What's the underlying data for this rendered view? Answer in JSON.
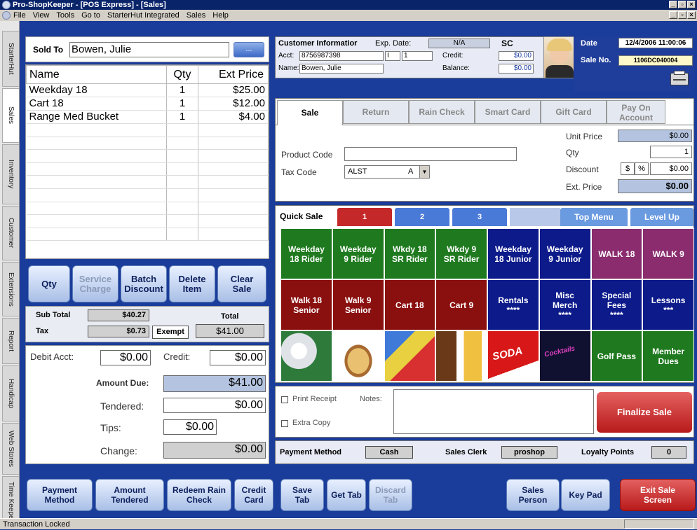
{
  "window": {
    "title": "Pro-ShopKeeper - [POS Express] - [Sales]"
  },
  "menu": [
    "File",
    "View",
    "Tools",
    "Go to",
    "StarterHut Integrated",
    "Sales",
    "Help"
  ],
  "side_tabs": [
    "StarterHut",
    "Sales",
    "Inventory",
    "Customer",
    "Extensions",
    "Report",
    "Handicap",
    "Web Stores",
    "Time Keeper"
  ],
  "sold_to": {
    "label": "Sold To",
    "value": "Bowen, Julie",
    "browse": "..."
  },
  "grid": {
    "headers": [
      "Name",
      "Qty",
      "Ext Price"
    ],
    "rows": [
      {
        "name": "Weekday 18",
        "qty": "1",
        "price": "$25.00"
      },
      {
        "name": "Cart 18",
        "qty": "1",
        "price": "$12.00"
      },
      {
        "name": "Range Med Bucket",
        "qty": "1",
        "price": "$4.00"
      }
    ]
  },
  "line_buttons": {
    "qty": "Qty",
    "service1": "Service",
    "service2": "Charge",
    "batch1": "Batch",
    "batch2": "Discount",
    "delete1": "Delete",
    "delete2": "Item",
    "clear1": "Clear",
    "clear2": "Sale"
  },
  "totals": {
    "subtotal_label": "Sub Total",
    "subtotal": "$40.27",
    "tax_label": "Tax",
    "tax": "$0.73",
    "exempt": "Exempt",
    "total_label": "Total",
    "total": "$41.00"
  },
  "payment": {
    "debit_label": "Debit Acct:",
    "debit": "$0.00",
    "credit_label": "Credit:",
    "credit": "$0.00",
    "due_label": "Amount Due:",
    "due": "$41.00",
    "tendered_label": "Tendered:",
    "tendered": "$0.00",
    "tips_label": "Tips:",
    "tips": "$0.00",
    "change_label": "Change:",
    "change": "$0.00"
  },
  "customer": {
    "title": "Customer Informatior",
    "exp_label": "Exp. Date:",
    "exp": "N/A",
    "code": "SC",
    "acct_label": "Acct:",
    "acct": "8756987398",
    "acct_f1": "I",
    "acct_f2": "1",
    "credit_label": "Credit:",
    "credit": "$0.00",
    "name_label": "Name:",
    "name": "Bowen, Julie",
    "balance_label": "Balance:",
    "balance": "$0.00"
  },
  "sale_info": {
    "date_label": "Date",
    "date": "12/4/2006 11:00:06",
    "saleno_label": "Sale No.",
    "saleno": "1106DC040004"
  },
  "sale_tabs": [
    "Sale",
    "Return",
    "Rain Check",
    "Smart Card",
    "Gift Card",
    "Pay On Account"
  ],
  "product": {
    "code_label": "Product Code",
    "code": "",
    "tax_label": "Tax Code",
    "tax": "ALST",
    "tax_opt": "A",
    "unit_label": "Unit Price",
    "unit": "$0.00",
    "qty_label": "Qty",
    "qty": "1",
    "disc_label": "Discount",
    "disc_cur": "$",
    "disc_pct": "%",
    "disc": "$0.00",
    "ext_label": "Ext. Price",
    "ext": "$0.00"
  },
  "quick_sale": {
    "label": "Quick Sale",
    "tabs": [
      "1",
      "2",
      "3"
    ],
    "top_menu": "Top Menu",
    "level_up": "Level Up",
    "buttons": [
      [
        "Weekday",
        "18 Rider"
      ],
      [
        "Weekday",
        "9 Rider"
      ],
      [
        "Wkdy 18",
        "SR Rider"
      ],
      [
        "Wkdy 9",
        "SR Rider"
      ],
      [
        "Weekday",
        "18 Junior"
      ],
      [
        "Weekday",
        "9 Junior"
      ],
      [
        "WALK 18",
        ""
      ],
      [
        "WALK 9",
        ""
      ],
      [
        "Walk 18",
        "Senior"
      ],
      [
        "Walk 9",
        "Senior"
      ],
      [
        "Cart 18",
        ""
      ],
      [
        "Cart 9",
        ""
      ],
      [
        "Rentals",
        "****"
      ],
      [
        "Misc",
        "Merch",
        "****"
      ],
      [
        "Special",
        "Fees",
        "****"
      ],
      [
        "Lessons",
        "***"
      ],
      [
        "Golf Pass",
        ""
      ],
      [
        "Member",
        "Dues"
      ]
    ],
    "image_text": [
      "SODA",
      "Cocktails"
    ]
  },
  "receipt": {
    "print": "Print Receipt",
    "notes_label": "Notes:",
    "extra": "Extra Copy",
    "finalize": "Finalize Sale"
  },
  "paybar": {
    "method_label": "Payment Method",
    "method": "Cash",
    "clerk_label": "Sales Clerk",
    "clerk": "proshop",
    "loyalty_label": "Loyalty Points",
    "loyalty": "0"
  },
  "bottom_buttons": [
    [
      "Payment",
      "Method"
    ],
    [
      "Amount",
      "Tendered"
    ],
    [
      "Redeem Rain",
      "Check"
    ],
    [
      "Credit",
      "Card"
    ],
    [
      "Save",
      "Tab"
    ],
    [
      "Get Tab",
      ""
    ],
    [
      "Discard",
      "Tab"
    ],
    [
      "Sales",
      "Person"
    ],
    [
      "Key Pad",
      ""
    ],
    [
      "Exit Sale",
      "Screen"
    ]
  ],
  "status": "Transaction Locked",
  "colors": {
    "green": "#1f7a1f",
    "navy": "#0c1a8a",
    "maroon": "#8a0f0f",
    "purple": "#8a2c6e",
    "frame": "#1a3c9a"
  }
}
